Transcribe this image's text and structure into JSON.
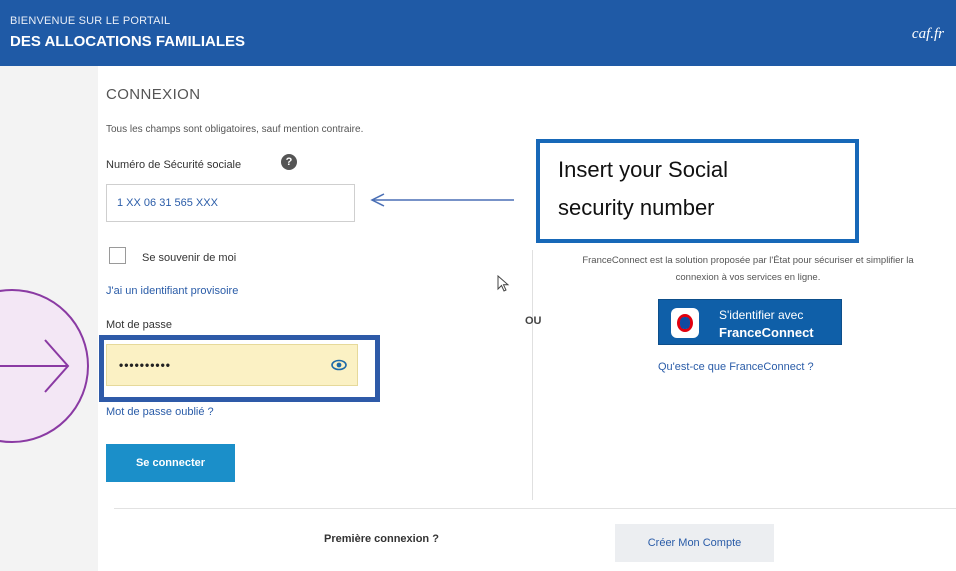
{
  "header": {
    "line1": "BIENVENUE SUR LE PORTAIL",
    "line2": "DES ALLOCATIONS FAMILIALES",
    "logo": "caf.fr"
  },
  "login": {
    "heading": "CONNEXION",
    "required_hint": "Tous les champs sont obligatoires, sauf mention contraire.",
    "ssn_label": "Numéro de Sécurité sociale",
    "ssn_value": "1 XX 06 31 565 XXX",
    "remember_label": "Se souvenir de moi",
    "temp_id_link": "J'ai un identifiant provisoire",
    "password_label": "Mot de passe",
    "password_value": "••••••••••",
    "forgot_link": "Mot de passe oublié ?",
    "submit_label": "Se connecter"
  },
  "separator": {
    "or": "OU"
  },
  "franceconnect": {
    "description_line1": "FranceConnect est la solution proposée par l'État pour sécuriser et simplifier la",
    "description_line2": "connexion à vos services en ligne.",
    "button_line1": "S'identifier avec",
    "button_line2": "FranceConnect",
    "info_link": "Qu'est-ce que FranceConnect ?"
  },
  "footer": {
    "first_connection": "Première connexion ?",
    "create_account": "Créer Mon Compte"
  },
  "annotation": {
    "line1": "Insert your  Social",
    "line2": "security number"
  },
  "colors": {
    "header_bg": "#1f5aa6",
    "link": "#2a5ca8",
    "primary_button": "#1b8fc9",
    "highlight_border": "#2e5aa8",
    "callout_border": "#1768b8",
    "circle_stroke": "#8a3aa3"
  },
  "icons": {
    "help": "question-circle-icon",
    "eye": "eye-icon",
    "cursor": "mouse-pointer-icon",
    "arrow": "arrow-left-icon",
    "circle_arrow": "arrow-right-icon"
  }
}
